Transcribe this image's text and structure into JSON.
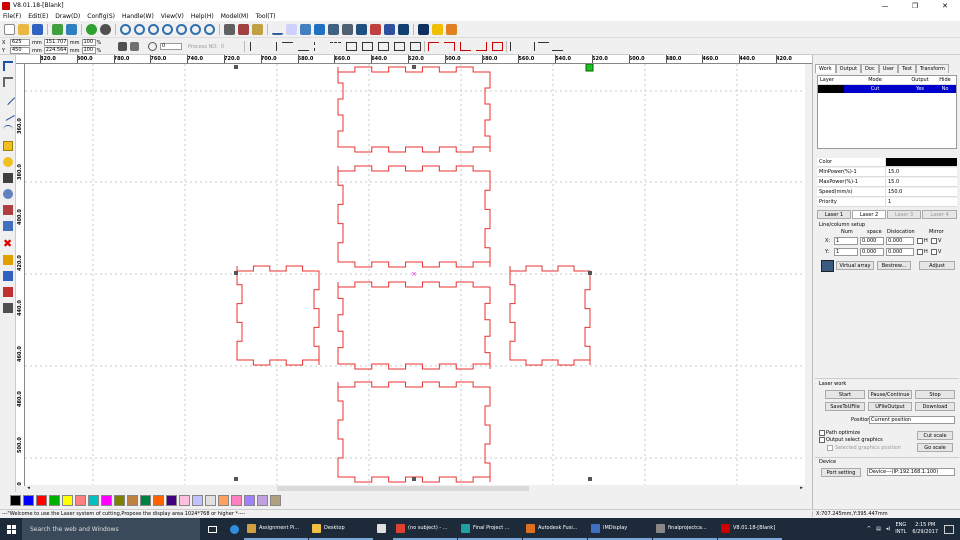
{
  "window": {
    "title": "V8.01.18-[Blank]",
    "minimize": "—",
    "maximize": "❐",
    "close": "✕"
  },
  "menu": [
    "File(F)",
    "Edit(E)",
    "Draw(D)",
    "Config(S)",
    "Handle(W)",
    "View(V)",
    "Help(H)",
    "Model(M)",
    "Tool(T)"
  ],
  "coords": {
    "x_label": "X",
    "x_val": "625",
    "x_unit": "mm",
    "w_val": "151.707",
    "w_unit": "mm",
    "x_pct": "100",
    "y_label": "Y",
    "y_val": "450",
    "y_unit": "mm",
    "h_val": "224.564",
    "h_unit": "mm",
    "y_pct": "100",
    "pct_sign": "%",
    "rotate_val": "0",
    "process_no": "Process NO:",
    "process_val": "0"
  },
  "ruler_h": [
    "820.0",
    "800.0",
    "780.0",
    "760.0",
    "740.0",
    "720.0",
    "700.0",
    "680.0",
    "660.0",
    "640.0",
    "620.0",
    "600.0",
    "580.0",
    "560.0",
    "540.0",
    "520.0",
    "500.0",
    "480.0",
    "460.0",
    "440.0",
    "420.0"
  ],
  "ruler_v": [
    "360.0",
    "380.0",
    "400.0",
    "420.0",
    "440.0",
    "460.0",
    "480.0",
    "500.0",
    "520.0",
    "540.0"
  ],
  "tabs": [
    "Work",
    "Output",
    "Doc",
    "User",
    "Test",
    "Transform"
  ],
  "layer_table": {
    "headers": [
      "Layer",
      "Mode",
      "Output",
      "Hide"
    ],
    "row": {
      "mode": "Cut",
      "output": "Yes",
      "hide": "No"
    }
  },
  "props": [
    {
      "k": "Color",
      "v": ""
    },
    {
      "k": "MinPower(%)-1",
      "v": "15.0"
    },
    {
      "k": "MaxPower(%)-1",
      "v": "15.0"
    },
    {
      "k": "Speed(mm/s)",
      "v": "150.0"
    },
    {
      "k": "Priority",
      "v": "1"
    }
  ],
  "laser_tabs": [
    "Laser 1",
    "Laser 2",
    "Laser 3",
    "Laser 4"
  ],
  "line_setup": {
    "title": "Line/column setup",
    "num": "Num",
    "space": "space",
    "disloc": "Dislocation",
    "mirror": "Mirror",
    "x_label": "X:",
    "y_label": "Y:",
    "x_num": "1",
    "x_space": "0.000",
    "x_disloc": "0.000",
    "y_num": "1",
    "y_space": "0.000",
    "y_disloc": "0.000",
    "h": "H",
    "v": "V"
  },
  "array_buttons": {
    "virtual": "Virtual array",
    "bestrew": "Bestrew...",
    "adjust": "Adjust"
  },
  "laser_work": {
    "title": "Laser work",
    "start": "Start",
    "pause": "Pause/Continue",
    "stop": "Stop",
    "save_to_ufile": "SaveToUFile",
    "ufile_output": "UFileOutput",
    "download": "Download",
    "position_label": "Position:",
    "position_value": "Current position",
    "path_optimize": "Path optimize",
    "output_select": "Output select graphics",
    "selected_scale": "Selected graphics position",
    "cut_scale": "Cut scale",
    "go_scale": "Go scale"
  },
  "device": {
    "title": "Device",
    "port_setting": "Port setting",
    "device_value": "Device---(IP:192.168.1.100)"
  },
  "palette": [
    "#000000",
    "#0000ff",
    "#ff0000",
    "#00b000",
    "#ffff00",
    "#ff8080",
    "#00c0c0",
    "#ff00ff",
    "#808000",
    "#c08040",
    "#008040",
    "#ff6000",
    "#400080",
    "#ffc0e0",
    "#c0c0ff",
    "#e0e0e0",
    "#ffa060",
    "#ff80c0",
    "#a080ff",
    "#c0a0e0",
    "#b0a080"
  ],
  "status": {
    "message": "---\"Welcome to use the Laser system of cutting,Propose the display area 1024*768 or higher *----",
    "coord": "X:707.245mm,Y:395.447mm"
  },
  "taskbar": {
    "search": "Search the web and Windows",
    "apps": [
      {
        "label": "Assignment Pi...",
        "color": "#d0a040"
      },
      {
        "label": "Desktop",
        "color": "#f0c040"
      },
      {
        "label": "",
        "color": "#e0e0e0"
      },
      {
        "label": "(no subject) - ...",
        "color": "#e04030"
      },
      {
        "label": "Final Project ...",
        "color": "#20a0a0"
      },
      {
        "label": "Autodesk Fusi...",
        "color": "#e07020"
      },
      {
        "label": "IMDisplay",
        "color": "#4070c0"
      },
      {
        "label": "finalprojectca...",
        "color": "#888888"
      },
      {
        "label": "V8.01.18-[Blank]",
        "color": "#cc0000"
      }
    ],
    "lang1": "ENG",
    "lang2": "INTL",
    "time": "2:15 PM",
    "date": "6/29/2017"
  }
}
